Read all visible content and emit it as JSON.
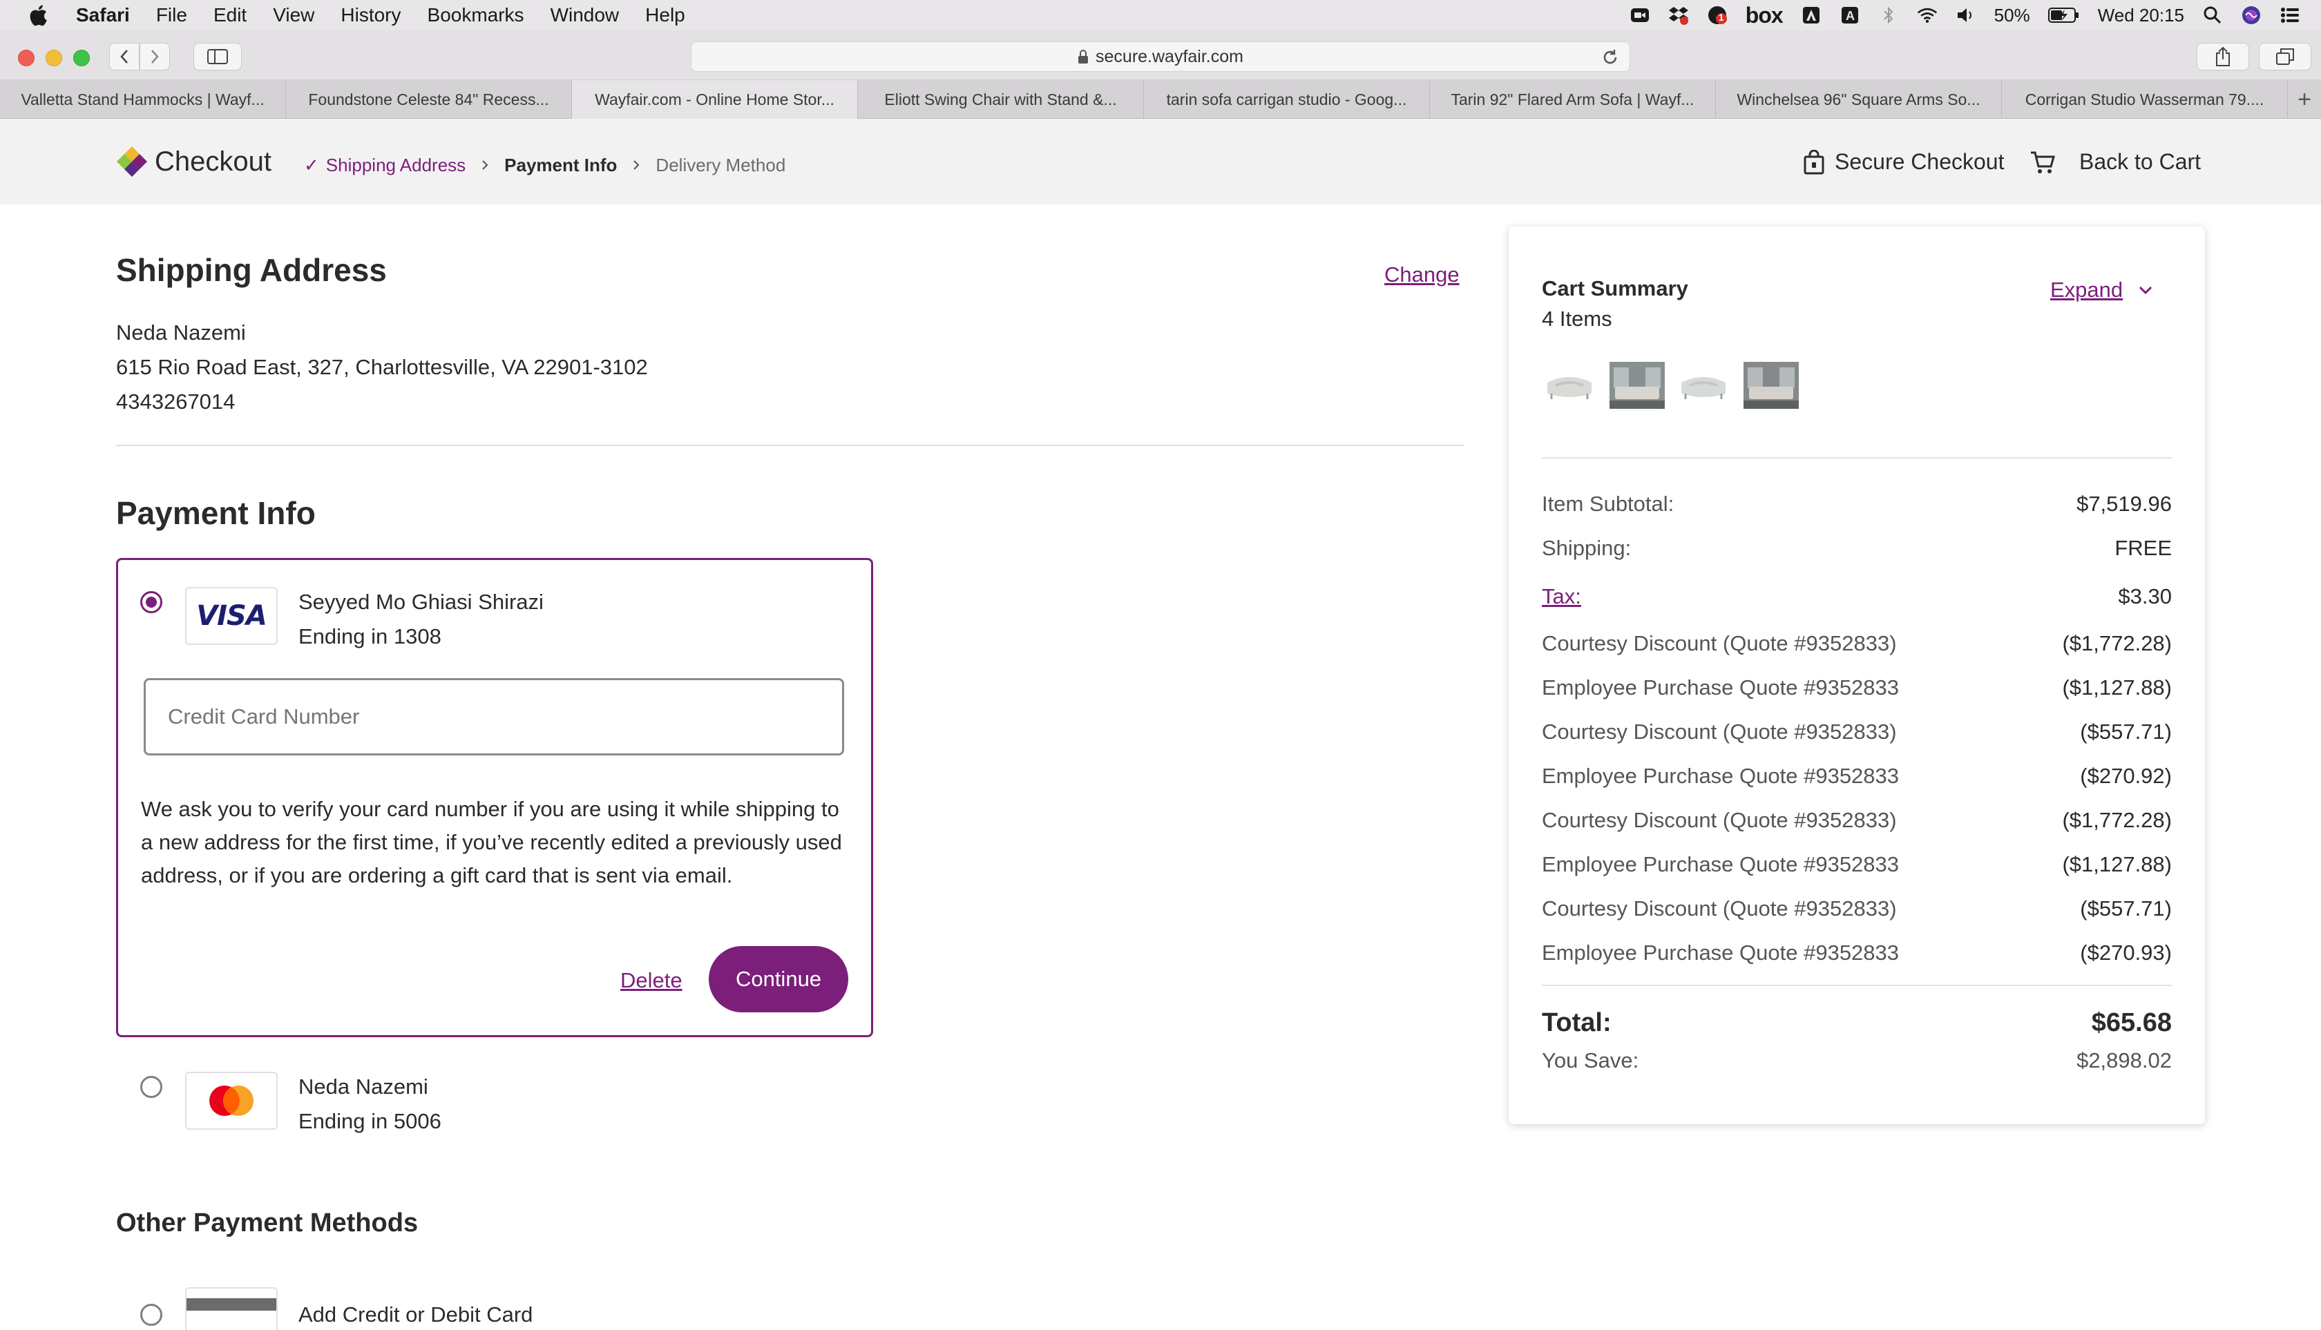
{
  "menubar": {
    "app": "Safari",
    "items": [
      "File",
      "Edit",
      "View",
      "History",
      "Bookmarks",
      "Window",
      "Help"
    ],
    "box": "box",
    "battery": "50%",
    "clock": "Wed 20:15",
    "badge": "1"
  },
  "browser": {
    "url": "secure.wayfair.com",
    "tabs": [
      "Valletta Stand Hammocks | Wayf...",
      "Foundstone Celeste 84\" Recess...",
      "Wayfair.com - Online Home Stor...",
      "Eliott Swing Chair with Stand &...",
      "tarin sofa carrigan studio - Goog...",
      "Tarin 92\" Flared Arm Sofa | Wayf...",
      "Winchelsea 96\" Square Arms So...",
      "Corrigan Studio Wasserman 79...."
    ],
    "new_tab": "+"
  },
  "header": {
    "title": "Checkout",
    "check": "✓",
    "crumb_done": "Shipping Address",
    "crumb_current": "Payment Info",
    "crumb_next": "Delivery Method",
    "secure": "Secure Checkout",
    "back_to_cart": "Back to Cart"
  },
  "shipping": {
    "heading": "Shipping Address",
    "change": "Change",
    "name": "Neda Nazemi",
    "address": "615 Rio Road East, 327, Charlottesville, VA 22901-3102",
    "phone": "4343267014"
  },
  "payment": {
    "heading": "Payment Info",
    "card1": {
      "brand": "VISA",
      "holder": "Seyyed Mo Ghiasi Shirazi",
      "ending": "Ending in 1308"
    },
    "cc_placeholder": "Credit Card Number",
    "verify_text": "We ask you to verify your card number if you are using it while shipping to a new address for the first time, if you’ve recently edited a previously used address, or if you are ordering a gift card that is sent via email.",
    "delete": "Delete",
    "continue": "Continue",
    "card2": {
      "holder": "Neda Nazemi",
      "ending": "Ending in 5006"
    }
  },
  "other": {
    "heading": "Other Payment Methods",
    "add_card": "Add Credit or Debit Card"
  },
  "cart": {
    "title": "Cart Summary",
    "count": "4 Items",
    "expand": "Expand",
    "rows": [
      {
        "label": "Item Subtotal:",
        "value": "$7,519.96"
      },
      {
        "label": "Shipping:",
        "value": "FREE"
      },
      {
        "label": "Tax:",
        "value": "$3.30"
      },
      {
        "label": "Courtesy Discount (Quote #9352833)",
        "value": "($1,772.28)"
      },
      {
        "label": "Employee Purchase Quote #9352833",
        "value": "($1,127.88)"
      },
      {
        "label": "Courtesy Discount (Quote #9352833)",
        "value": "($557.71)"
      },
      {
        "label": "Employee Purchase Quote #9352833",
        "value": "($270.92)"
      },
      {
        "label": "Courtesy Discount (Quote #9352833)",
        "value": "($1,772.28)"
      },
      {
        "label": "Employee Purchase Quote #9352833",
        "value": "($1,127.88)"
      },
      {
        "label": "Courtesy Discount (Quote #9352833)",
        "value": "($557.71)"
      },
      {
        "label": "Employee Purchase Quote #9352833",
        "value": "($270.93)"
      }
    ],
    "total_label": "Total:",
    "total_value": "$65.68",
    "save_label": "You Save:",
    "save_value": "$2,898.02"
  },
  "colors": {
    "brand": "#7b1f7b",
    "text": "#2b2b2b",
    "muted": "#555555"
  }
}
